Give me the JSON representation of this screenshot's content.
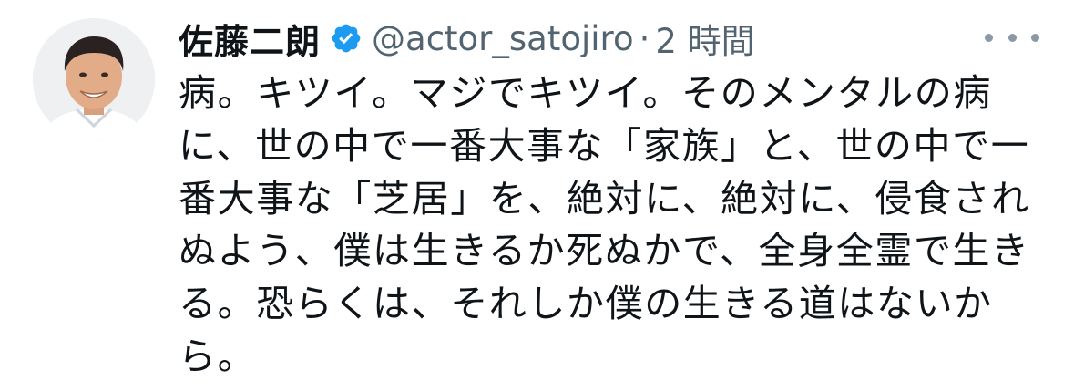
{
  "tweet": {
    "display_name": "佐藤二朗",
    "handle": "@actor_satojiro",
    "separator": "·",
    "time": "2 時間",
    "verified_icon": "verified-badge-icon",
    "more_icon": "more-options-icon",
    "lines": [
      "病。キツイ。マジでキツイ。そのメンタルの病",
      "に、世の中で一番大事な「家族」と、世の中で一",
      "番大事な「芝居」を、絶対に、絶対に、侵食され",
      "ぬよう、僕は生きるか死ぬかで、全身全霊で生き",
      "る。恐らくは、それしか僕の生きる道はないか",
      "ら。"
    ]
  },
  "colors": {
    "text": "#0f1419",
    "secondary": "#536471",
    "verified": "#1d9bf0",
    "background": "#ffffff"
  }
}
